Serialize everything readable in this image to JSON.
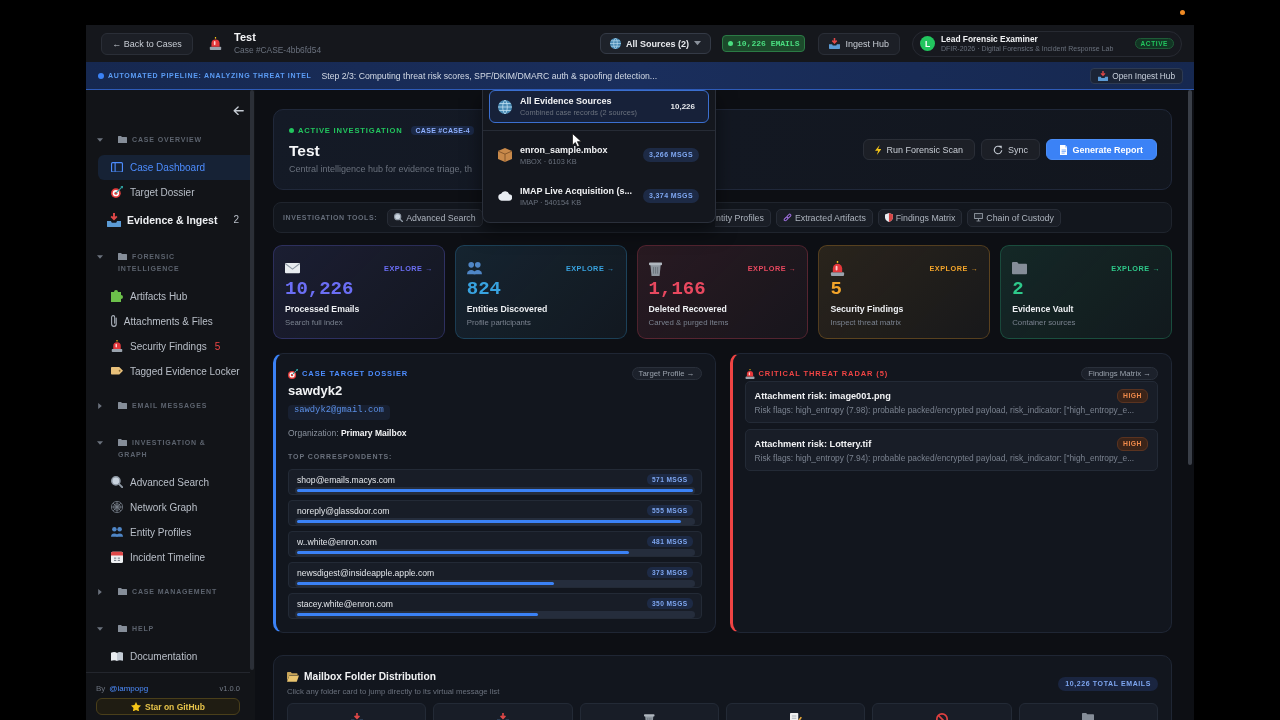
{
  "header": {
    "back_button": "← Back to Cases",
    "case_title": "Test",
    "case_id": "Case #CASE-4bb6fd54",
    "source_filter": {
      "label": "All Sources (2)",
      "expanded": true
    },
    "email_count": "10,226 EMAILS",
    "ingest_button": "Ingest Hub",
    "user": {
      "initial": "L",
      "name": "Lead Forensic Examiner",
      "organization": "DFIR-2026 · Digital Forensics & Incident Response Lab",
      "status": "ACTIVE"
    }
  },
  "pipeline_banner": {
    "title": "AUTOMATED PIPELINE: ANALYZING THREAT INTEL",
    "message": "Step 2/3: Computing threat risk scores, SPF/DKIM/DMARC auth & spoofing detection...",
    "button": "Open Ingest Hub"
  },
  "source_dropdown": {
    "options": [
      {
        "kind": "aggregate",
        "name": "All Evidence Sources",
        "detail": "Combined case records (2 sources)",
        "count": "10,226",
        "selected": true
      },
      {
        "kind": "source",
        "name": "enron_sample.mbox",
        "detail": "MBOX · 6103 KB",
        "count": "3,266 MSGS",
        "selected": false
      },
      {
        "kind": "source",
        "name": "IMAP Live Acquisition (s...",
        "detail": "IMAP · 540154 KB",
        "count": "3,374 MSGS",
        "selected": false
      }
    ]
  },
  "sidebar": {
    "sections": [
      {
        "title": "CASE OVERVIEW",
        "expanded": true,
        "items": [
          {
            "label": "Case Dashboard",
            "selected": true,
            "highlighted": false
          },
          {
            "label": "Target Dossier",
            "selected": false,
            "highlighted": false
          },
          {
            "label": "Evidence & Ingest",
            "selected": false,
            "highlighted": true,
            "count": {
              "text": "2",
              "alert": false
            }
          }
        ]
      },
      {
        "title": "FORENSIC INTELLIGENCE",
        "expanded": true,
        "items": [
          {
            "label": "Artifacts Hub",
            "selected": false,
            "highlighted": false
          },
          {
            "label": "Attachments & Files",
            "selected": false,
            "highlighted": false
          },
          {
            "label": "Security Findings",
            "selected": false,
            "highlighted": false,
            "count": {
              "text": "5",
              "alert": true
            }
          },
          {
            "label": "Tagged Evidence Locker",
            "selected": false,
            "highlighted": false
          }
        ]
      },
      {
        "title": "EMAIL MESSAGES",
        "expanded": false
      },
      {
        "title": "INVESTIGATION & GRAPH",
        "expanded": true,
        "items": [
          {
            "label": "Advanced Search",
            "selected": false,
            "highlighted": false
          },
          {
            "label": "Network Graph",
            "selected": false,
            "highlighted": false
          },
          {
            "label": "Entity Profiles",
            "selected": false,
            "highlighted": false
          },
          {
            "label": "Incident Timeline",
            "selected": false,
            "highlighted": false
          }
        ]
      },
      {
        "title": "CASE MANAGEMENT",
        "expanded": false
      },
      {
        "title": "HELP",
        "expanded": true,
        "items": [
          {
            "label": "Documentation",
            "selected": false,
            "highlighted": false
          }
        ]
      }
    ],
    "footer": {
      "author_prefix": "By",
      "author": "@iampopg",
      "version": "v1.0.0",
      "github_button": "Star on GitHub"
    }
  },
  "hero": {
    "status": "ACTIVE INVESTIGATION",
    "case_badge": "CASE #CASE-4",
    "title": "Test",
    "description": "Central intelligence hub for evidence triage, th",
    "buttons": [
      {
        "label": "Run Forensic Scan",
        "kind": "secondary"
      },
      {
        "label": "Sync",
        "kind": "secondary"
      },
      {
        "label": "Generate Report",
        "kind": "primary"
      }
    ]
  },
  "tools": {
    "label": "INVESTIGATION TOOLS:",
    "items": [
      "Advanced Search",
      "ntity Profiles",
      "Extracted Artifacts",
      "Findings Matrix",
      "Chain of Custody"
    ]
  },
  "stat_cards": [
    {
      "value": "10,226",
      "label": "Processed Emails",
      "caption": "Search full index",
      "link": "EXPLORE →",
      "color": "#6b6ef5"
    },
    {
      "value": "824",
      "label": "Entities Discovered",
      "caption": "Profile participants",
      "link": "EXPLORE →",
      "color": "#38a3e0"
    },
    {
      "value": "1,166",
      "label": "Deleted Recovered",
      "caption": "Carved & purged items",
      "link": "EXPLORE →",
      "color": "#e8485f"
    },
    {
      "value": "5",
      "label": "Security Findings",
      "caption": "Inspect threat matrix",
      "link": "EXPLORE →",
      "color": "#f2a42a"
    },
    {
      "value": "2",
      "label": "Evidence Vault",
      "caption": "Container sources",
      "link": "EXPLORE →",
      "color": "#2ec98a"
    }
  ],
  "dossier": {
    "heading": "CASE TARGET DOSSIER",
    "link": "Target Profile →",
    "name": "sawdyk2",
    "email": "sawdyk2@gmail.com",
    "organization": "Organization: **Primary Mailbox**",
    "correspondents_heading": "TOP CORRESPONDENTS:",
    "correspondents": [
      {
        "email": "shop@emails.macys.com",
        "count": "571 MSGS",
        "level": 1
      },
      {
        "email": "noreply@glassdoor.com",
        "count": "555 MSGS",
        "level": 0.97
      },
      {
        "email": "w..white@enron.com",
        "count": "481 MSGS",
        "level": 0.84
      },
      {
        "email": "newsdigest@insideapple.apple.com",
        "count": "373 MSGS",
        "level": 0.65
      },
      {
        "email": "stacey.white@enron.com",
        "count": "350 MSGS",
        "level": 0.61
      }
    ]
  },
  "threat_radar": {
    "heading": "CRITICAL THREAT RADAR (5)",
    "link": "Findings Matrix →",
    "findings": [
      {
        "title": "Attachment risk: image001.png",
        "severity": "HIGH",
        "detail": "Risk flags: high_entropy (7.98): probable packed/encrypted payload, risk_indicator: [\"high_entropy_e..."
      },
      {
        "title": "Attachment risk: Lottery.tif",
        "severity": "HIGH",
        "detail": "Risk flags: high_entropy (7.94): probable packed/encrypted payload, risk_indicator: [\"high_entropy_e..."
      }
    ]
  },
  "mailbox_distribution": {
    "title": "Mailbox Folder Distribution",
    "subtitle": "Click any folder card to jump directly to its virtual message list",
    "total": "10,226 TOTAL EMAILS"
  }
}
